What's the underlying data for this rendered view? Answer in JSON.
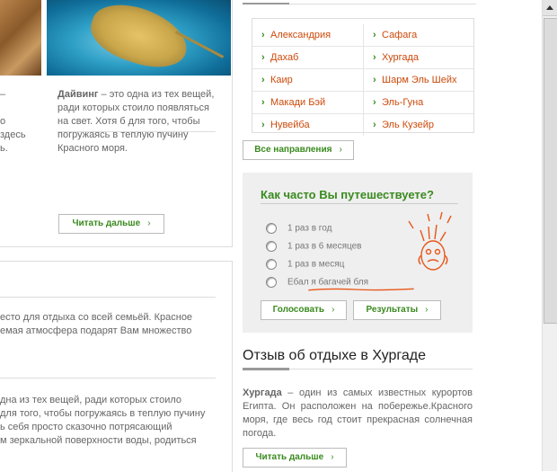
{
  "left": {
    "dive_lead": "Дайвинг",
    "dive_text": " – это одна из тех вещей, ради которых стоило появляться на свет. Хотя б для того, чтобы погружаясь в теплую пучину Красного моря.",
    "frag_left": "–\n\nо\nздесь\nь.",
    "read_more_1": "Читать дальше",
    "lower_1": "есто для отдыха со всей семьёй. Красное\nемая атмосфера подарят Вам множество",
    "lower_2": "дна из тех вещей, ради которых стоило\nдля того, чтобы погружаясь в теплую пучину\nь себя просто сказочно потрясающий\nм зеркальной поверхности воды, родиться"
  },
  "destinations": {
    "rows": [
      [
        "Александрия",
        "Сафага"
      ],
      [
        "Дахаб",
        "Хургада"
      ],
      [
        "Каир",
        "Шарм Эль Шейх"
      ],
      [
        "Макади Бэй",
        "Эль-Гуна"
      ],
      [
        "Нувейба",
        "Эль Кузейр"
      ]
    ],
    "all_button": "Все направления"
  },
  "poll": {
    "title": "Как часто Вы путешествуете?",
    "options": [
      "1 раз в год",
      "1 раз в 6 месяцев",
      "1 раз в месяц",
      "Ебал я багачей бля"
    ],
    "vote_button": "Голосовать",
    "results_button": "Результаты"
  },
  "review": {
    "title": "Отзыв об отдыхе в Хургаде",
    "lead": "Хургада",
    "text": " – один из самых известных курортов Египта. Он расположен на побережье.Красного моря, где весь год стоит прекрасная солнечная погода.",
    "read_more": "Читать дальше"
  },
  "colors": {
    "accent_green": "#3a8a1f",
    "link_orange": "#cc4a0b",
    "scribble_red": "#e8561a"
  },
  "arrow_glyph": "›"
}
